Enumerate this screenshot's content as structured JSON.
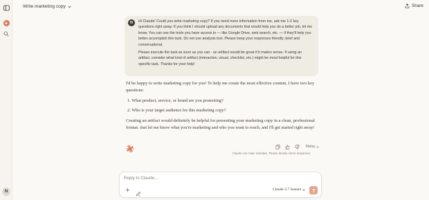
{
  "sidebar": {
    "user_initial": "N",
    "new_chat_glyph": "+"
  },
  "header": {
    "chat_title": "Write marketing copy",
    "share_label": "Share"
  },
  "user_message": {
    "avatar_initial": "N",
    "paragraph1": "Hi Claude! Could you write marketing copy? If you need more information from me, ask me 1-2 key questions right away. If you think I should upload any documents that would help you do a better job, let me know. You can use the tools you have access to — like Google Drive, web search, etc. — if they'll help you better accomplish this task. Do not use analysis tool. Please keep your responses friendly, brief and conversational.",
    "paragraph2": "Please execute the task as soon as you can - an artifact would be great if it makes sense. If using an artifact, consider what kind of artifact (interactive, visual, checklist, etc.) might be most helpful for this specific task. Thanks for your help!"
  },
  "assistant_reply": {
    "intro": "I'd be happy to write marketing copy for you! To help me create the most effective content, I have two key questions:",
    "questions": [
      "1. What product, service, or brand are you promoting?",
      "2. Who is your target audience for this marketing copy?"
    ],
    "closing": "Creating an artifact would definitely be helpful for presenting your marketing copy in a clean, professional format. Just let me know what you're marketing and who you want to reach, and I'll get started right away!"
  },
  "message_actions": {
    "retry_label": "Retry",
    "disclaimer": "Claude can make mistakes. Please double-check responses."
  },
  "composer": {
    "placeholder": "Reply to Claude...",
    "model_label": "Claude 3.7 Sonnet"
  },
  "colors": {
    "accent": "#d97757",
    "send_button": "#e8a48a",
    "background": "#faf9f6",
    "user_bubble": "#efece4"
  },
  "icons": [
    "sidebar-toggle-icon",
    "new-chat-icon",
    "search-icon",
    "chevron-down-icon",
    "share-icon",
    "claude-spark-icon",
    "copy-icon",
    "thumbs-up-icon",
    "thumbs-down-icon",
    "plus-icon",
    "pen-tool-icon",
    "arrow-up-icon"
  ]
}
